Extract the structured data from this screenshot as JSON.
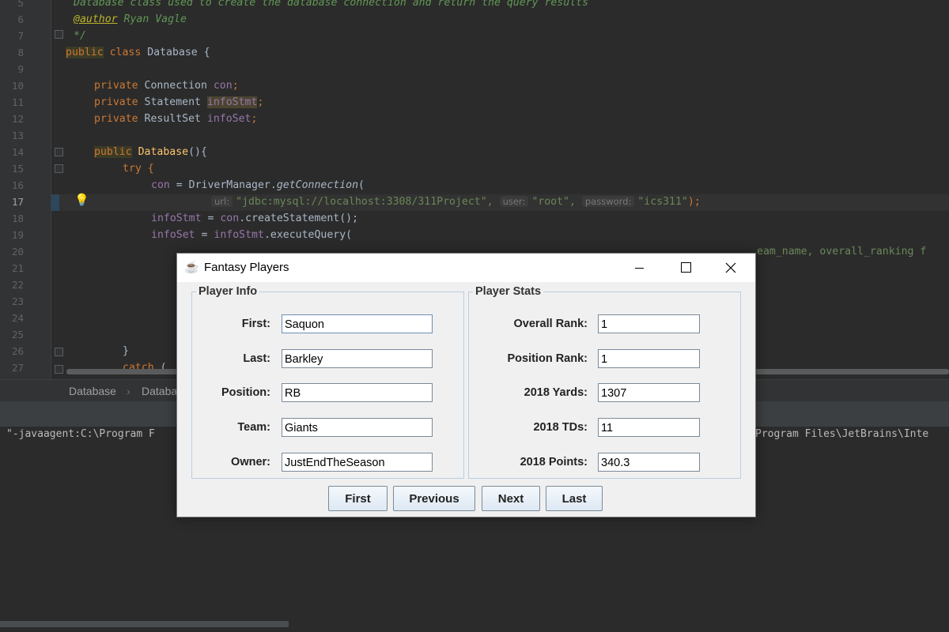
{
  "editor": {
    "line_numbers": [
      "5",
      "6",
      "7",
      "8",
      "9",
      "10",
      "11",
      "12",
      "13",
      "14",
      "15",
      "16",
      "17",
      "18",
      "19",
      "20",
      "21",
      "22",
      "23",
      "24",
      "25",
      "26",
      "27"
    ],
    "code": {
      "l5": "Database class used to create the database connection and return the query results",
      "l6_tag": "@author",
      "l6_text": " Ryan Vagle",
      "l7": "*/",
      "l8_kw": "public",
      "l8_rest_kw": " class",
      "l8_rest": " Database {",
      "l10_kw": "private",
      "l10_type": " Connection ",
      "l10_field": "con",
      "l10_end": ";",
      "l11_kw": "private",
      "l11_type": " Statement ",
      "l11_field": "infoStmt",
      "l11_end": ";",
      "l12_kw": "private",
      "l12_type": " ResultSet ",
      "l12_field": "infoSet",
      "l12_end": ";",
      "l14_kw": "public",
      "l14_fn": " Database",
      "l14_rest": "(){",
      "l15": "try {",
      "l16_field": "con",
      "l16_mid": " = DriverManager.",
      "l16_fn": "getConnection",
      "l16_end": "(",
      "l17_hint_url": "url:",
      "l17_url": "\"jdbc:mysql://localhost:3308/311Project\",",
      "l17_hint_user": "user:",
      "l17_user": "\"root\",",
      "l17_hint_pw": "password:",
      "l17_pw": "\"ics311\"",
      "l17_end": ");",
      "l18_field": "infoStmt",
      "l18_mid": " = ",
      "l18_field2": "con",
      "l18_end": ".createStatement();",
      "l19_field": "infoSet",
      "l19_mid": " = ",
      "l19_field2": "infoStmt",
      "l19_end": ".executeQuery(",
      "l20_tail": "eam_name, overall_ranking f",
      "l26": "}",
      "l27_kw": "catch",
      "l27_rest": " (",
      "l27_tail": "("
    },
    "breadcrumbs": [
      "Database",
      "Databa"
    ],
    "run_output_left": "\"-javaagent:C:\\Program F",
    "run_output_right": "Program Files\\JetBrains\\Inte"
  },
  "dialog": {
    "title": "Fantasy Players",
    "player_info": {
      "legend": "Player Info",
      "fields": [
        {
          "label": "First:",
          "value": "Saquon"
        },
        {
          "label": "Last:",
          "value": "Barkley"
        },
        {
          "label": "Position:",
          "value": "RB"
        },
        {
          "label": "Team:",
          "value": "Giants"
        },
        {
          "label": "Owner:",
          "value": "JustEndTheSeason"
        }
      ]
    },
    "player_stats": {
      "legend": "Player Stats",
      "fields": [
        {
          "label": "Overall Rank:",
          "value": "1"
        },
        {
          "label": "Position Rank:",
          "value": "1"
        },
        {
          "label": "2018 Yards:",
          "value": "1307"
        },
        {
          "label": "2018 TDs:",
          "value": "11"
        },
        {
          "label": "2018 Points:",
          "value": "340.3"
        }
      ]
    },
    "buttons": {
      "first": "First",
      "previous": "Previous",
      "next": "Next",
      "last": "Last"
    }
  },
  "colors": {
    "editor_bg": "#2b2b2b",
    "keyword": "#cc7832",
    "field": "#9876aa",
    "string": "#6a8759",
    "doc_comment": "#629755",
    "function": "#ffc66d",
    "dialog_bg": "#f0f0f0",
    "group_border": "#b8cfe5"
  },
  "icons": {
    "app_icon": "java-cup-icon",
    "bulb": "lightbulb-icon",
    "close": "close-icon"
  }
}
